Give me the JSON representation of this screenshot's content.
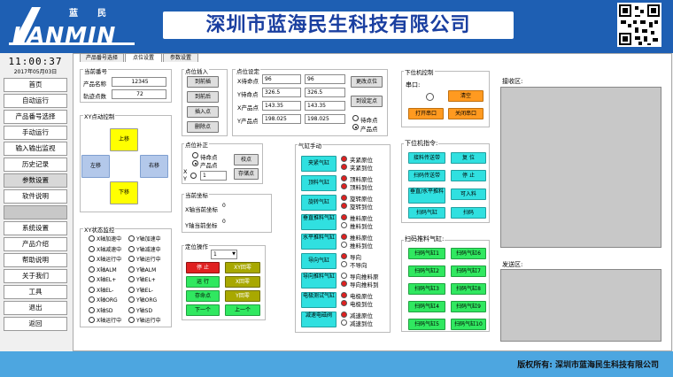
{
  "header": {
    "logo_text": "LANMIN",
    "logo_cn": "蓝民",
    "title": "深圳市蓝海民生科技有限公司"
  },
  "clock": {
    "time": "11:00:37",
    "date": "2017年05月03日"
  },
  "nav": [
    "首页",
    "自动运行",
    "产品番号选择",
    "手动运行",
    "输入输出监视",
    "历史记录",
    "参数设置",
    "软件说明",
    "",
    "系统设置",
    "产品介绍",
    "帮助说明",
    "关于我们",
    "工具",
    "退出",
    "返回"
  ],
  "tabs": [
    "产品番号选择",
    "点位设置",
    "参数设置"
  ],
  "current_no": {
    "title": "当前番号",
    "name_label": "产品名称",
    "name_value": "12345",
    "count_label": "轨迹点数",
    "count_value": "72"
  },
  "xy_move": {
    "title": "XY点动控制",
    "up": "上移",
    "left": "左移",
    "right": "右移",
    "down": "下移"
  },
  "xy_status": {
    "title": "XY状态监控",
    "items": [
      [
        "X轴加速中",
        "Y轴加速中"
      ],
      [
        "X轴减速中",
        "Y轴减速中"
      ],
      [
        "X轴运行中",
        "Y轴运行中"
      ],
      [
        "X轴ALM",
        "Y轴ALM"
      ],
      [
        "X轴EL+",
        "Y轴EL+"
      ],
      [
        "X轴EL-",
        "Y轴EL-"
      ],
      [
        "X轴ORG",
        "Y轴ORG"
      ],
      [
        "X轴SD",
        "Y轴SD"
      ],
      [
        "X轴运行中",
        "Y轴运行中"
      ]
    ]
  },
  "point_insert": {
    "title": "点位插入",
    "b1": "到前插",
    "b2": "到前后",
    "b3": "插入点",
    "b4": "删除点"
  },
  "point_set": {
    "title": "点位设定",
    "rows": [
      {
        "label": "X待命点",
        "v1": "96",
        "v2": "96"
      },
      {
        "label": "Y待命点",
        "v1": "326.5",
        "v2": "326.5"
      },
      {
        "label": "X产品点",
        "v1": "143.35",
        "v2": "143.35"
      },
      {
        "label": "Y产品点",
        "v1": "198.025",
        "v2": "198.025"
      }
    ],
    "btn_update": "更改点位",
    "btn_goto": "到设定点",
    "r1": "待命点",
    "r2": "产品点"
  },
  "point_fix": {
    "title": "点位补正",
    "r1": "待命点",
    "r2": "产品点",
    "x": "X",
    "y": "Y",
    "value": "1",
    "btn1": "校点",
    "btn2": "存储点"
  },
  "cur_coord": {
    "title": "当前坐标",
    "x_label": "X轴当前坐标",
    "x_value": "0",
    "y_label": "Y轴当前坐标",
    "y_value": "0"
  },
  "locate": {
    "title": "定位操作",
    "select": "1",
    "buttons": [
      [
        "停 止",
        "XY回零"
      ],
      [
        "运 行",
        "X回零"
      ],
      [
        "存命点",
        "Y回零"
      ],
      [
        "下一个",
        "上一个"
      ]
    ]
  },
  "cylinder": {
    "title": "气缸手动",
    "items": [
      {
        "btn": "夹紧气缸",
        "l1": "夹紧原位",
        "l2": "夹紧到位",
        "s1": "red",
        "s2": "red"
      },
      {
        "btn": "顶料气缸",
        "l1": "顶料原位",
        "l2": "顶料到位",
        "s1": "red",
        "s2": "red"
      },
      {
        "btn": "旋转气缸",
        "l1": "旋转原位",
        "l2": "旋转到位",
        "s1": "red",
        "s2": "red"
      },
      {
        "btn": "垂直推料气缸",
        "l1": "推料原位",
        "l2": "推料到位",
        "s1": "red",
        "s2": "off"
      },
      {
        "btn": "水平推料气缸",
        "l1": "推料原位",
        "l2": "推料到位",
        "s1": "red",
        "s2": "off"
      },
      {
        "btn": "导向气缸",
        "l1": "导向",
        "l2": "不导向",
        "s1": "red",
        "s2": "off"
      },
      {
        "btn": "导向推料气缸",
        "l1": "导向推料原",
        "l2": "导向推料到",
        "s1": "off",
        "s2": "red"
      },
      {
        "btn": "电极测试气缸",
        "l1": "电极原位",
        "l2": "电极到位",
        "s1": "red",
        "s2": "red"
      },
      {
        "btn": "减速电磁阀",
        "l1": "减速原位",
        "l2": "减速到位",
        "s1": "red",
        "s2": "off"
      }
    ]
  },
  "lower": {
    "title": "下位机控制",
    "serial_label": "串口:",
    "clear": "清空",
    "open": "打开串口",
    "close": "关闭串口"
  },
  "lower_cmd": {
    "title": "下位机指令:",
    "buttons": [
      [
        "接料传送带",
        "复 位"
      ],
      [
        "扫码传送带",
        "停 止"
      ],
      [
        "垂直/水平推料",
        "可入料"
      ],
      [
        "扫码气缸",
        "扫码"
      ]
    ]
  },
  "scan": {
    "title": "扫码推料气缸:",
    "buttons": [
      [
        "扫码气缸1",
        "扫码气缸6"
      ],
      [
        "扫码气缸2",
        "扫码气缸7"
      ],
      [
        "扫码气缸3",
        "扫码气缸8"
      ],
      [
        "扫码气缸4",
        "扫码气缸9"
      ],
      [
        "扫码气缸5",
        "扫码气缸10"
      ]
    ]
  },
  "recv": {
    "title": "接收区:"
  },
  "send": {
    "title": "发送区:"
  },
  "footer": {
    "text": "版权所有:  深圳市蓝海民生科技有限公司"
  }
}
